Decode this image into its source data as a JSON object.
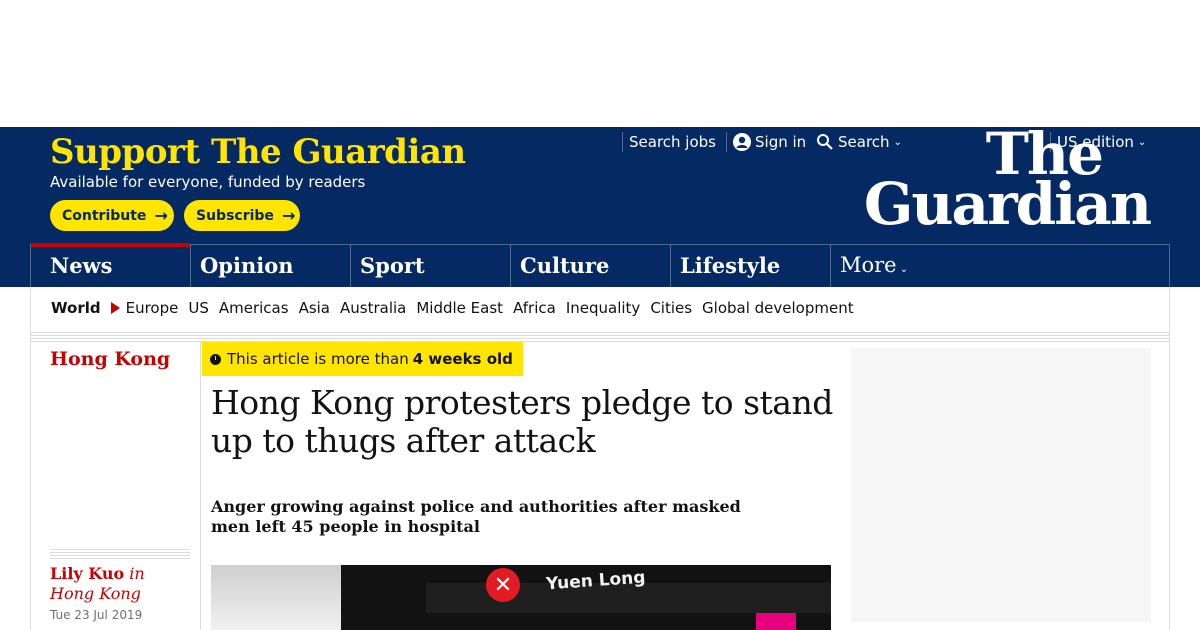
{
  "header": {
    "support_title": "Support The Guardian",
    "support_sub": "Available for everyone, funded by readers",
    "contribute": "Contribute",
    "subscribe": "Subscribe",
    "links": {
      "jobs": "Search jobs",
      "signin": "Sign in",
      "search": "Search",
      "edition": "US edition"
    },
    "logo_line1": "The",
    "logo_line2": "Guardian",
    "colors": {
      "brand_blue": "#052962",
      "yellow": "#ffe500",
      "news_red": "#c70000"
    }
  },
  "nav": {
    "items": [
      "News",
      "Opinion",
      "Sport",
      "Culture",
      "Lifestyle"
    ],
    "more": "More"
  },
  "subnav": {
    "current": "World",
    "items": [
      "Europe",
      "US",
      "Americas",
      "Asia",
      "Australia",
      "Middle East",
      "Africa",
      "Inequality",
      "Cities",
      "Global development"
    ]
  },
  "article": {
    "section": "Hong Kong",
    "age_prefix": "This article is more than",
    "age_value": "4 weeks old",
    "headline": "Hong Kong protesters pledge to stand up to thugs after attack",
    "standfirst": "Anger growing against police and authorities after masked men left 45 people in hospital",
    "author": "Lily Kuo",
    "author_location": "in Hong Kong",
    "date": "Tue 23 Jul 2019",
    "hero_sign": "Yuen Long"
  }
}
